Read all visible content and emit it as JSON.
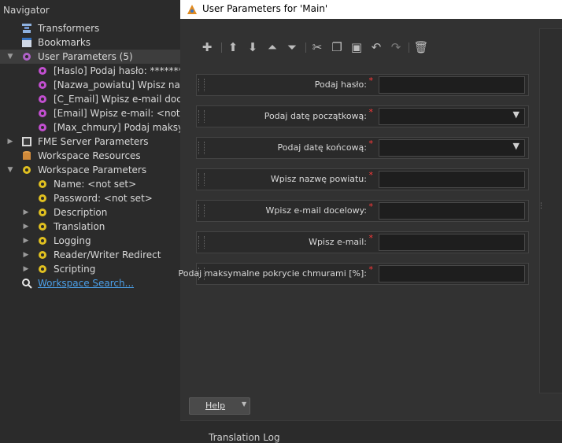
{
  "navigator": {
    "title": "Navigator",
    "items": [
      {
        "label": "Transformers",
        "icon": "transformers-icon"
      },
      {
        "label": "Bookmarks",
        "icon": "bookmarks-icon"
      },
      {
        "label": "User Parameters (5)",
        "icon": "user-parameters-gear-icon",
        "expanded": true,
        "selected": true
      },
      {
        "label": "[Haslo] Podaj hasło: ********",
        "icon": "user-parameter-gear-icon"
      },
      {
        "label": "[Nazwa_powiatu] Wpisz nazwę",
        "icon": "user-parameter-gear-icon"
      },
      {
        "label": "[C_Email] Wpisz e-mail docelo",
        "icon": "user-parameter-gear-icon"
      },
      {
        "label": "[Email] Wpisz e-mail: <not set",
        "icon": "user-parameter-gear-icon"
      },
      {
        "label": "[Max_chmury] Podaj maksyma",
        "icon": "user-parameter-gear-icon"
      },
      {
        "label": "FME Server Parameters",
        "icon": "fme-server-parameters-icon"
      },
      {
        "label": "Workspace Resources",
        "icon": "workspace-resources-icon"
      },
      {
        "label": "Workspace Parameters",
        "icon": "workspace-parameters-gear-icon",
        "expanded": true
      },
      {
        "label": "Name: <not set>",
        "icon": "workspace-parameter-gear-icon"
      },
      {
        "label": "Password: <not set>",
        "icon": "workspace-parameter-gear-icon"
      },
      {
        "label": "Description",
        "icon": "workspace-parameter-gear-icon"
      },
      {
        "label": "Translation",
        "icon": "workspace-parameter-gear-icon"
      },
      {
        "label": "Logging",
        "icon": "workspace-parameter-gear-icon"
      },
      {
        "label": "Reader/Writer Redirect",
        "icon": "workspace-parameter-gear-icon"
      },
      {
        "label": "Scripting",
        "icon": "workspace-parameter-gear-icon"
      },
      {
        "label": "Workspace Search...",
        "icon": "search-icon",
        "link": true
      }
    ]
  },
  "dialog": {
    "title": "User Parameters for 'Main'",
    "toolbar": [
      "add-icon",
      "move-up-icon",
      "move-down-icon",
      "move-to-top-icon",
      "move-to-bottom-icon",
      "cut-icon",
      "copy-icon",
      "paste-icon",
      "undo-icon",
      "redo-icon",
      "delete-icon"
    ],
    "params": [
      {
        "label": "Podaj hasło:",
        "type": "password",
        "value": ""
      },
      {
        "label": "Podaj datę początkową:",
        "type": "dropdown",
        "value": ""
      },
      {
        "label": "Podaj datę końcową:",
        "type": "dropdown",
        "value": ""
      },
      {
        "label": "Wpisz nazwę powiatu:",
        "type": "text",
        "value": ""
      },
      {
        "label": "Wpisz e-mail docelowy:",
        "type": "text",
        "value": ""
      },
      {
        "label": "Wpisz e-mail:",
        "type": "text",
        "value": ""
      },
      {
        "label": "Podaj maksymalne pokrycie chmurami [%]:",
        "type": "text",
        "value": ""
      }
    ],
    "required_marker": "*",
    "help_label": "Help"
  },
  "bottom": {
    "translation_log": "Translation Log"
  },
  "colors": {
    "background": "#2b2b2b",
    "link": "#4b9fe8",
    "required": "#ff3a3a"
  }
}
